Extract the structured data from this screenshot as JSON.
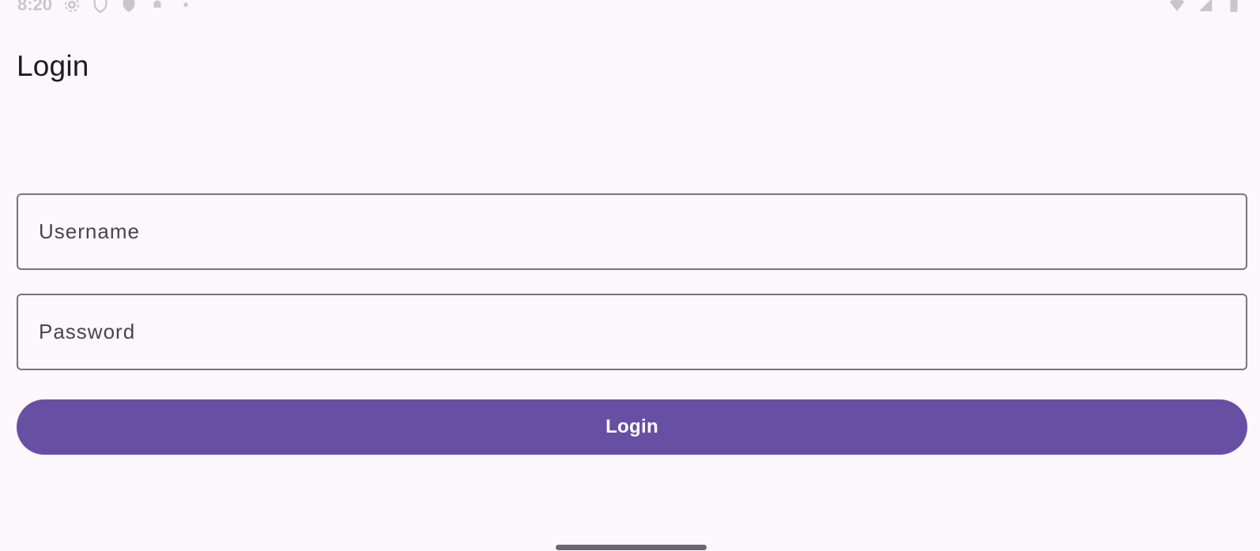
{
  "status_bar": {
    "time": "8:20",
    "left_icons": [
      "settings-icon",
      "shield-icon",
      "shield-filled-icon",
      "notification-icon",
      "dot-icon"
    ],
    "right_icons": [
      "wifi-icon",
      "signal-icon",
      "battery-icon"
    ]
  },
  "app_bar": {
    "title": "Login"
  },
  "form": {
    "username": {
      "label": "Username",
      "value": ""
    },
    "password": {
      "label": "Password",
      "value": ""
    },
    "submit_label": "Login"
  },
  "colors": {
    "background": "#FCF6FD",
    "primary": "#6750A4",
    "outline": "#79747E",
    "on_surface": "#1D1B20",
    "on_surface_variant": "#49454F"
  }
}
